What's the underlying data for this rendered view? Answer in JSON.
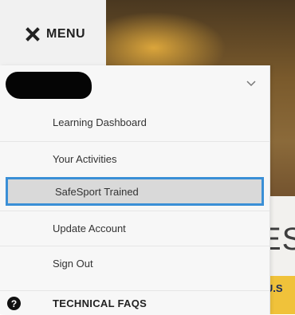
{
  "menu_toggle": {
    "label": "MENU",
    "icon": "close-icon"
  },
  "user": {
    "chevron_icon": "chevron-down-icon"
  },
  "menu_items": [
    {
      "label": "Learning Dashboard",
      "selected": false
    },
    {
      "label": "Your Activities",
      "selected": false
    },
    {
      "label": "SafeSport Trained",
      "selected": true
    },
    {
      "label": "Update Account",
      "selected": false
    },
    {
      "label": "Sign Out",
      "selected": false
    }
  ],
  "faq": {
    "label": "TECHNICAL FAQS",
    "icon": "question-circle-icon"
  },
  "background": {
    "big_text": "ES",
    "banner_text": "e U.S"
  },
  "colors": {
    "selected_border": "#3a8fd6",
    "selected_bg": "#d9d9d9",
    "banner": "#f0c23a"
  }
}
